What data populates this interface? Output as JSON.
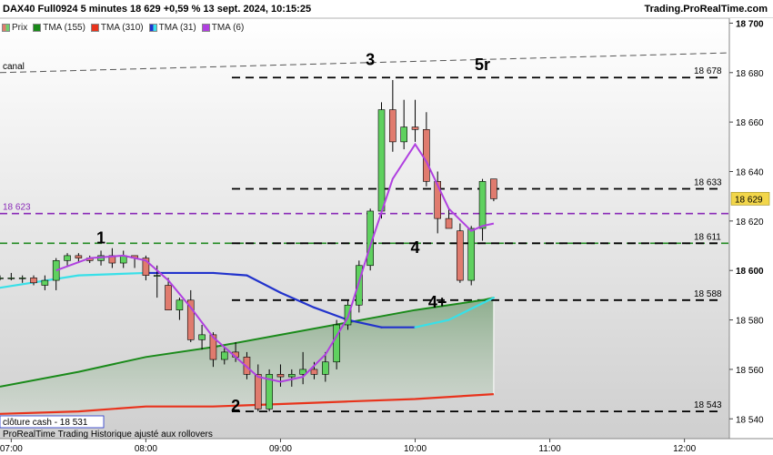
{
  "header": {
    "title": "DAX40 Full0924 5 minutes 18 629 +0,59 % 13 sept. 2024, 10:15:25",
    "brand": "Trading.ProRealTime.com"
  },
  "legend": [
    {
      "label": "Prix",
      "color": "#e07b6e"
    },
    {
      "label": "TMA (155)",
      "color": "#1a8a1a"
    },
    {
      "label": "TMA (310)",
      "color": "#e8331c"
    },
    {
      "label": "TMA (31)",
      "color": "#2233cc"
    },
    {
      "label": "TMA (6)",
      "color": "#b040e0"
    }
  ],
  "footer": {
    "close_cash": "clôture cash - 18 531",
    "note": "ProRealTime Trading Historique ajusté aux rollovers"
  },
  "chart_data": {
    "type": "candlestick",
    "ylim": [
      18532,
      18702
    ],
    "xlim": [
      "06:55",
      "12:20"
    ],
    "x_ticks": [
      "07:00",
      "08:00",
      "09:00",
      "10:00",
      "11:00",
      "12:00"
    ],
    "y_ticks": [
      "18 700",
      "18 680",
      "18 660",
      "18 640",
      "18 620",
      "18 600",
      "18 580",
      "18 560",
      "18 540"
    ],
    "last_price": {
      "value": 18629,
      "label": "18 629"
    },
    "candles": [
      {
        "t": "06:55",
        "o": 18597,
        "h": 18598,
        "l": 18596,
        "c": 18597
      },
      {
        "t": "07:00",
        "o": 18597,
        "h": 18599,
        "l": 18596,
        "c": 18597
      },
      {
        "t": "07:05",
        "o": 18597,
        "h": 18598,
        "l": 18595,
        "c": 18597
      },
      {
        "t": "07:10",
        "o": 18597,
        "h": 18598,
        "l": 18594,
        "c": 18595
      },
      {
        "t": "07:15",
        "o": 18594,
        "h": 18598,
        "l": 18592,
        "c": 18596
      },
      {
        "t": "07:20",
        "o": 18596,
        "h": 18605,
        "l": 18592,
        "c": 18604
      },
      {
        "t": "07:25",
        "o": 18604,
        "h": 18607,
        "l": 18602,
        "c": 18606
      },
      {
        "t": "07:30",
        "o": 18606,
        "h": 18607,
        "l": 18603,
        "c": 18605
      },
      {
        "t": "07:35",
        "o": 18605,
        "h": 18606,
        "l": 18603,
        "c": 18604
      },
      {
        "t": "07:40",
        "o": 18604,
        "h": 18608,
        "l": 18602,
        "c": 18606
      },
      {
        "t": "07:45",
        "o": 18606,
        "h": 18609,
        "l": 18601,
        "c": 18603
      },
      {
        "t": "07:50",
        "o": 18603,
        "h": 18608,
        "l": 18601,
        "c": 18606
      },
      {
        "t": "07:55",
        "o": 18606,
        "h": 18606,
        "l": 18601,
        "c": 18605
      },
      {
        "t": "08:00",
        "o": 18605,
        "h": 18606,
        "l": 18596,
        "c": 18598
      },
      {
        "t": "08:05",
        "o": 18598,
        "h": 18602,
        "l": 18589,
        "c": 18598
      },
      {
        "t": "08:10",
        "o": 18594,
        "h": 18597,
        "l": 18584,
        "c": 18584
      },
      {
        "t": "08:15",
        "o": 18584,
        "h": 18589,
        "l": 18580,
        "c": 18588
      },
      {
        "t": "08:20",
        "o": 18588,
        "h": 18592,
        "l": 18571,
        "c": 18572
      },
      {
        "t": "08:25",
        "o": 18572,
        "h": 18578,
        "l": 18568,
        "c": 18574
      },
      {
        "t": "08:30",
        "o": 18574,
        "h": 18575,
        "l": 18561,
        "c": 18564
      },
      {
        "t": "08:35",
        "o": 18564,
        "h": 18569,
        "l": 18562,
        "c": 18567
      },
      {
        "t": "08:40",
        "o": 18567,
        "h": 18571,
        "l": 18563,
        "c": 18565
      },
      {
        "t": "08:45",
        "o": 18565,
        "h": 18567,
        "l": 18556,
        "c": 18558
      },
      {
        "t": "08:50",
        "o": 18558,
        "h": 18562,
        "l": 18543,
        "c": 18544
      },
      {
        "t": "08:55",
        "o": 18544,
        "h": 18560,
        "l": 18543,
        "c": 18558
      },
      {
        "t": "09:00",
        "o": 18558,
        "h": 18562,
        "l": 18553,
        "c": 18557
      },
      {
        "t": "09:05",
        "o": 18557,
        "h": 18560,
        "l": 18553,
        "c": 18558
      },
      {
        "t": "09:10",
        "o": 18558,
        "h": 18567,
        "l": 18554,
        "c": 18560
      },
      {
        "t": "09:15",
        "o": 18560,
        "h": 18563,
        "l": 18556,
        "c": 18558
      },
      {
        "t": "09:20",
        "o": 18558,
        "h": 18567,
        "l": 18555,
        "c": 18563
      },
      {
        "t": "09:25",
        "o": 18563,
        "h": 18580,
        "l": 18560,
        "c": 18578
      },
      {
        "t": "09:30",
        "o": 18578,
        "h": 18588,
        "l": 18576,
        "c": 18586
      },
      {
        "t": "09:35",
        "o": 18586,
        "h": 18604,
        "l": 18583,
        "c": 18602
      },
      {
        "t": "09:40",
        "o": 18602,
        "h": 18625,
        "l": 18600,
        "c": 18624
      },
      {
        "t": "09:45",
        "o": 18624,
        "h": 18668,
        "l": 18621,
        "c": 18665
      },
      {
        "t": "09:50",
        "o": 18665,
        "h": 18677,
        "l": 18648,
        "c": 18652
      },
      {
        "t": "09:55",
        "o": 18652,
        "h": 18669,
        "l": 18649,
        "c": 18658
      },
      {
        "t": "10:00",
        "o": 18658,
        "h": 18669,
        "l": 18652,
        "c": 18657
      },
      {
        "t": "10:05",
        "o": 18657,
        "h": 18664,
        "l": 18634,
        "c": 18636
      },
      {
        "t": "10:10",
        "o": 18636,
        "h": 18640,
        "l": 18615,
        "c": 18621
      },
      {
        "t": "10:15",
        "o": 18621,
        "h": 18625,
        "l": 18617,
        "c": 18617
      },
      {
        "t": "10:20",
        "o": 18616,
        "h": 18619,
        "l": 18595,
        "c": 18596
      },
      {
        "t": "10:25",
        "o": 18596,
        "h": 18618,
        "l": 18594,
        "c": 18617
      },
      {
        "t": "10:30",
        "o": 18617,
        "h": 18637,
        "l": 18612,
        "c": 18636
      },
      {
        "t": "10:35",
        "o": 18637,
        "h": 18637,
        "l": 18628,
        "c": 18629
      }
    ],
    "series": [
      {
        "name": "TMA (155)",
        "color": "#1a8a1a",
        "points": [
          [
            "06:55",
            18553
          ],
          [
            "07:30",
            18559
          ],
          [
            "08:00",
            18565
          ],
          [
            "08:30",
            18569
          ],
          [
            "09:00",
            18574
          ],
          [
            "09:30",
            18579
          ],
          [
            "10:00",
            18584
          ],
          [
            "10:30",
            18588
          ],
          [
            "10:35",
            18589
          ]
        ]
      },
      {
        "name": "TMA (310)",
        "color": "#e8331c",
        "points": [
          [
            "06:55",
            18542
          ],
          [
            "07:30",
            18543
          ],
          [
            "08:00",
            18545
          ],
          [
            "08:30",
            18545
          ],
          [
            "09:00",
            18546
          ],
          [
            "09:30",
            18547
          ],
          [
            "10:00",
            18548
          ],
          [
            "10:35",
            18550
          ]
        ]
      },
      {
        "name": "TMA (31)",
        "color": "#2233cc",
        "points": [
          [
            "06:55",
            18593
          ],
          [
            "07:30",
            18598
          ],
          [
            "08:00",
            18599
          ],
          [
            "08:30",
            18599
          ],
          [
            "08:45",
            18598
          ],
          [
            "09:00",
            18591
          ],
          [
            "09:15",
            18585
          ],
          [
            "09:30",
            18580
          ],
          [
            "09:45",
            18577
          ],
          [
            "10:00",
            18577
          ],
          [
            "10:15",
            18580
          ],
          [
            "10:35",
            18589
          ]
        ]
      },
      {
        "name": "TMA (6)",
        "color": "#b040e0",
        "points": [
          [
            "07:20",
            18600
          ],
          [
            "07:35",
            18605
          ],
          [
            "07:50",
            18606
          ],
          [
            "08:00",
            18604
          ],
          [
            "08:10",
            18596
          ],
          [
            "08:20",
            18585
          ],
          [
            "08:30",
            18573
          ],
          [
            "08:40",
            18565
          ],
          [
            "08:50",
            18557
          ],
          [
            "09:00",
            18555
          ],
          [
            "09:10",
            18557
          ],
          [
            "09:20",
            18566
          ],
          [
            "09:30",
            18581
          ],
          [
            "09:40",
            18610
          ],
          [
            "09:50",
            18637
          ],
          [
            "10:00",
            18651
          ],
          [
            "10:05",
            18644
          ],
          [
            "10:15",
            18625
          ],
          [
            "10:25",
            18616
          ],
          [
            "10:30",
            18618
          ],
          [
            "10:35",
            18619
          ]
        ]
      }
    ],
    "levels": [
      {
        "value": 18678,
        "label": "18 678",
        "color": "#000000"
      },
      {
        "value": 18633,
        "label": "18 633",
        "color": "#000000"
      },
      {
        "value": 18611,
        "label": "18 611",
        "color": "#000000"
      },
      {
        "value": 18588,
        "label": "18 588",
        "color": "#000000"
      },
      {
        "value": 18543,
        "label": "18 543",
        "color": "#000000"
      }
    ],
    "full_lines": [
      {
        "value": 18623,
        "label": "18 623",
        "color": "#8a2bb8"
      },
      {
        "value": 18611,
        "label": "",
        "color": "#228b22"
      },
      {
        "value": 18531,
        "label": "",
        "color": "#1a2bb8"
      }
    ],
    "channel": {
      "label": "canal",
      "from": [
        "06:55",
        18680
      ],
      "to": [
        "12:20",
        18688
      ]
    },
    "wave_labels": [
      {
        "text": "1",
        "t": "07:40",
        "v": 18611
      },
      {
        "text": "2",
        "t": "08:40",
        "v": 18543
      },
      {
        "text": "3",
        "t": "09:40",
        "v": 18683
      },
      {
        "text": "4",
        "t": "10:00",
        "v": 18607
      },
      {
        "text": "4+",
        "t": "10:10",
        "v": 18585
      },
      {
        "text": "5r",
        "t": "10:30",
        "v": 18681
      }
    ]
  }
}
